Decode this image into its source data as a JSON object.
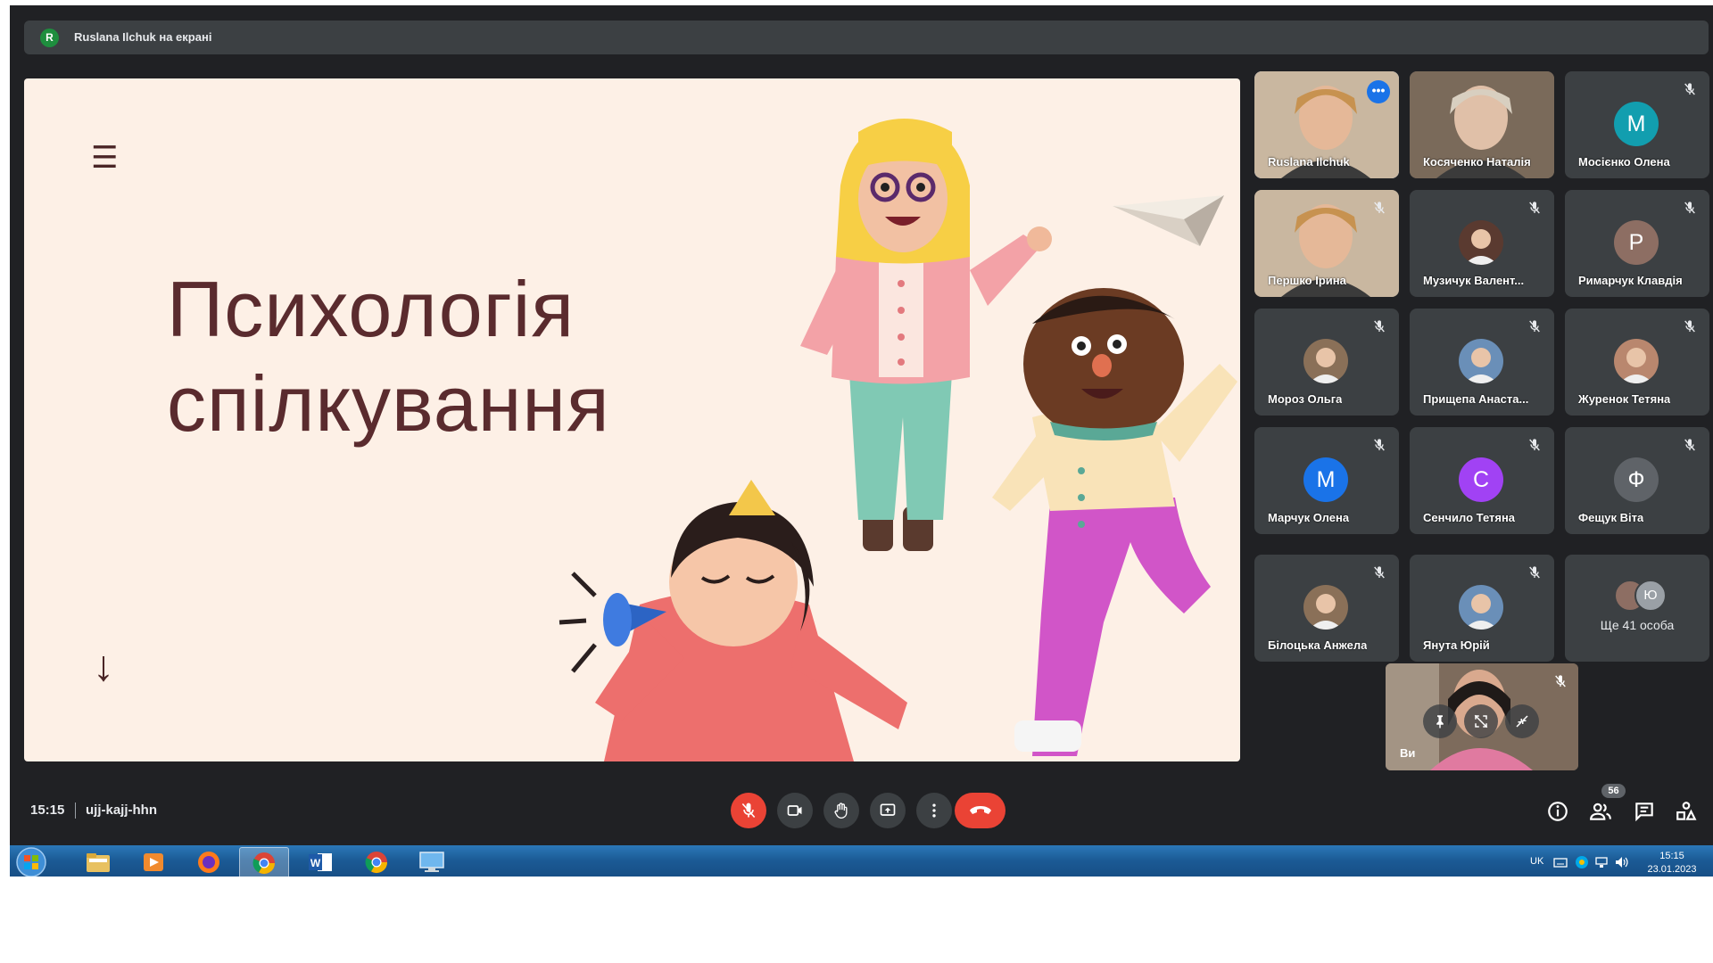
{
  "presenting_bar": {
    "avatar_letter": "R",
    "text": "Ruslana Ilchuk на екрані"
  },
  "slide": {
    "menu_glyph": "☰",
    "title_line1": "Психологія",
    "title_line2": "спілкування",
    "down_arrow": "↓"
  },
  "participants": [
    {
      "name": "Ruslana Ilchuk",
      "kind": "video",
      "active": true
    },
    {
      "name": "Косяченко Наталія",
      "kind": "video"
    },
    {
      "name": "Мосієнко Олена",
      "kind": "letter",
      "letter": "М",
      "color": "#129eaf"
    },
    {
      "name": "Першко Ірина",
      "kind": "video"
    },
    {
      "name": "Музичук Валент...",
      "kind": "photo"
    },
    {
      "name": "Римарчук Клавдія",
      "kind": "letter",
      "letter": "Р",
      "color": "#8d6e63"
    },
    {
      "name": "Мороз Ольга",
      "kind": "photo"
    },
    {
      "name": "Прищепа Анаста...",
      "kind": "photo"
    },
    {
      "name": "Журенок Тетяна",
      "kind": "photo"
    },
    {
      "name": "Марчук Олена",
      "kind": "letter",
      "letter": "М",
      "color": "#1a73e8"
    },
    {
      "name": "Сенчило Тетяна",
      "kind": "letter",
      "letter": "С",
      "color": "#a142f4"
    },
    {
      "name": "Фещук Віта",
      "kind": "letter",
      "letter": "Ф",
      "color": "#5f6368"
    },
    {
      "name": "Білоцька Анжела",
      "kind": "photo"
    },
    {
      "name": "Янута Юрій",
      "kind": "photo"
    }
  ],
  "others": {
    "label": "Ще 41 особа",
    "letter": "Ю",
    "color": "#9aa0a6"
  },
  "self_view": {
    "label": "Ви"
  },
  "bottom": {
    "time": "15:15",
    "meeting_code": "ujj-kajj-hhn",
    "people_count": "56"
  },
  "taskbar": {
    "language": "UK",
    "time": "15:15",
    "date": "23.01.2023"
  },
  "colors": {
    "accent_blue": "#8ab4f8",
    "end_call_red": "#ea4335",
    "slide_bg": "#fdf0e6",
    "title_brown": "#5a2b2e"
  }
}
